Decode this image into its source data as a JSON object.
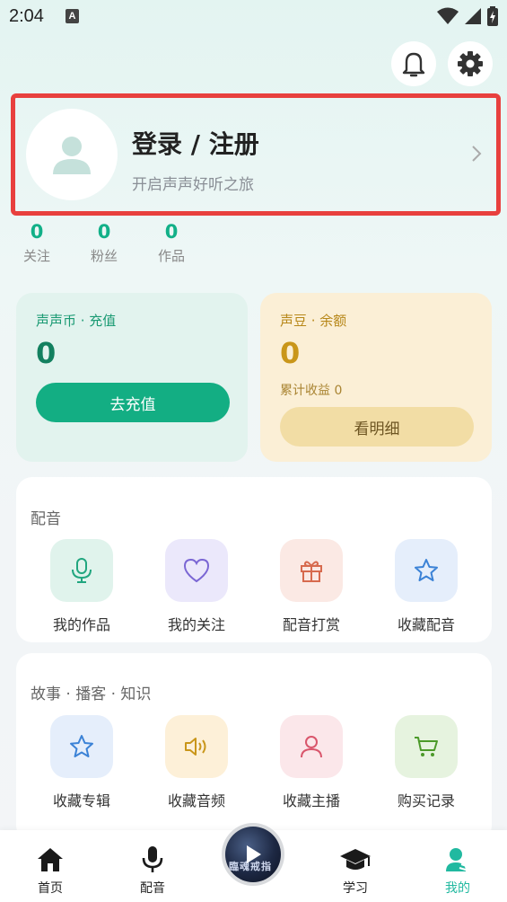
{
  "status": {
    "time": "2:04",
    "indicator": "A"
  },
  "profile": {
    "title": "登录 / 注册",
    "subtitle": "开启声声好听之旅"
  },
  "stats": [
    {
      "value": "0",
      "label": "关注"
    },
    {
      "value": "0",
      "label": "粉丝"
    },
    {
      "value": "0",
      "label": "作品"
    }
  ],
  "coins": {
    "title": "声声币 · 充值",
    "value": "0",
    "button": "去充值"
  },
  "beans": {
    "title": "声豆 · 余额",
    "value": "0",
    "earnings": "累计收益 0",
    "button": "看明细"
  },
  "dubbing": {
    "title": "配音",
    "items": [
      {
        "label": "我的作品",
        "icon": "microphone-icon"
      },
      {
        "label": "我的关注",
        "icon": "heart-icon"
      },
      {
        "label": "配音打赏",
        "icon": "gift-icon"
      },
      {
        "label": "收藏配音",
        "icon": "star-icon"
      }
    ]
  },
  "stories": {
    "title": "故事 · 播客 · 知识",
    "items": [
      {
        "label": "收藏专辑",
        "icon": "star-icon"
      },
      {
        "label": "收藏音频",
        "icon": "speaker-icon"
      },
      {
        "label": "收藏主播",
        "icon": "person-icon"
      },
      {
        "label": "购买记录",
        "icon": "cart-icon"
      }
    ]
  },
  "tabs": [
    {
      "label": "首页",
      "icon": "home-icon"
    },
    {
      "label": "配音",
      "icon": "microphone-icon"
    },
    {
      "label": "学习",
      "icon": "graduation-cap-icon"
    },
    {
      "label": "我的",
      "icon": "profile-icon"
    }
  ],
  "player": {
    "cover_text": "臨魂戒指"
  },
  "colors": {
    "accent": "#12b088",
    "gold": "#c9961a",
    "login_border": "#e8403e"
  }
}
